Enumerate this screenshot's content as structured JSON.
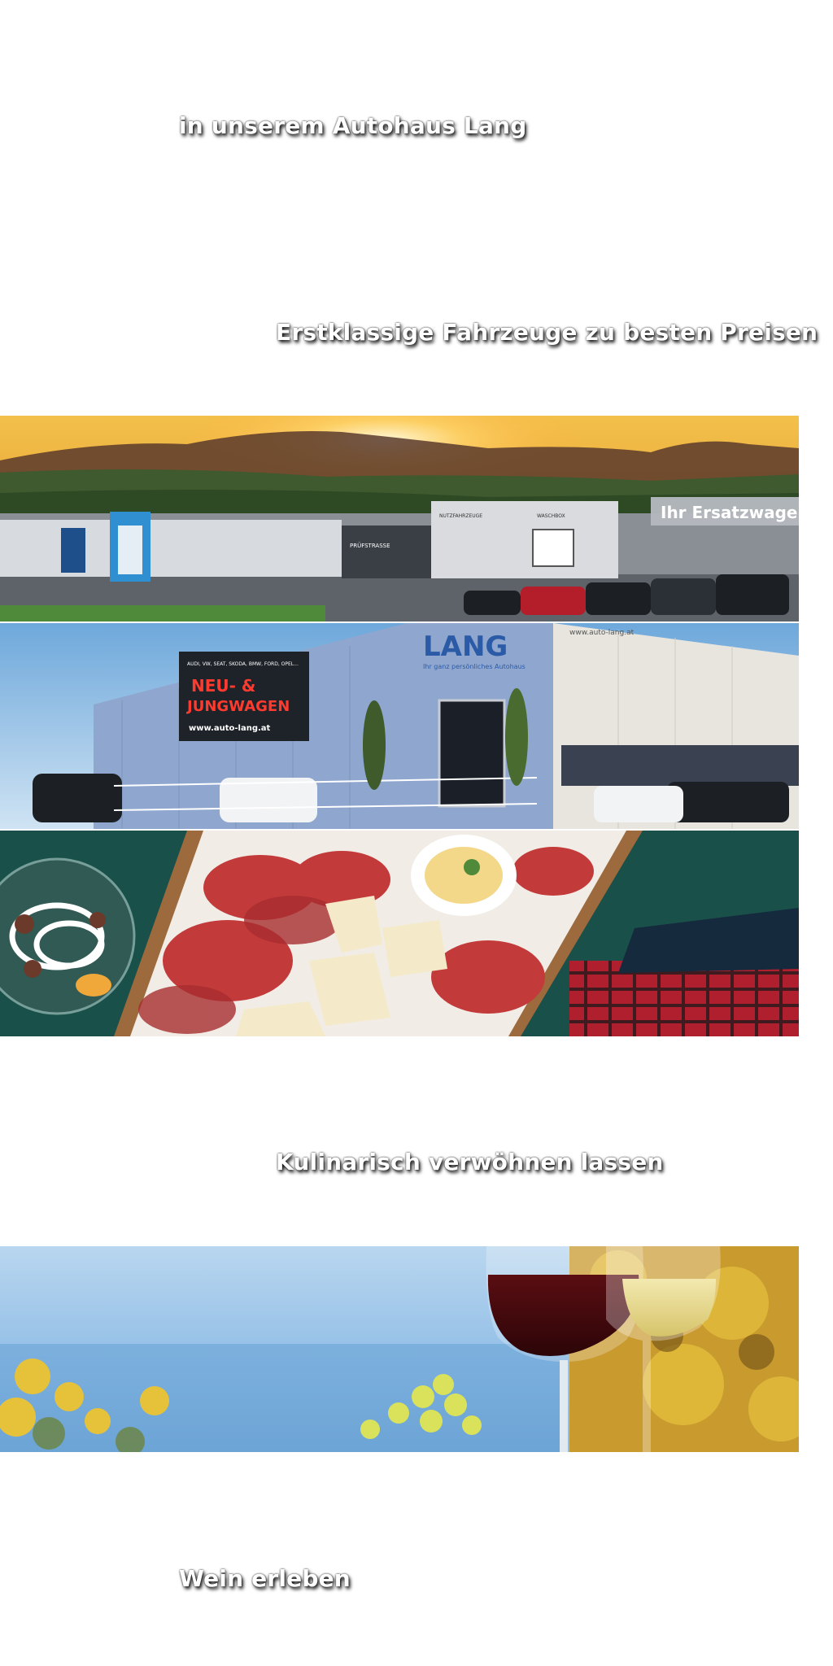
{
  "headings": {
    "autohaus": "in unserem Autohaus Lang",
    "fahrzeuge": "Erstklassige Fahrzeuge zu besten Preisen",
    "kulinarisch": "Kulinarisch verwöhnen lassen",
    "wein": "Wein erleben"
  },
  "photos": {
    "dealership": {
      "sign_ersatzwagen": "Ihr Ersatzwage",
      "label_pruefstrasse": "PRÜFSTRASSE",
      "label_nutzfahrzeuge": "NUTZFAHRZEUGE",
      "label_waschbox": "WASCHBOX"
    },
    "building": {
      "brand": "LANG",
      "brand_tagline": "Ihr ganz persönliches Autohaus",
      "banner_brands": "AUDI, VW, SEAT, SKODA, BMW, FORD, OPEL...",
      "banner_headline_1": "NEU- &",
      "banner_headline_2": "JUNGWAGEN",
      "banner_url": "www.auto-lang.at",
      "top_url": "www.auto-lang.at"
    }
  },
  "colors": {
    "caption_text": "#ffffff",
    "caption_shadow": "#000000",
    "page_background": "#ffffff"
  }
}
